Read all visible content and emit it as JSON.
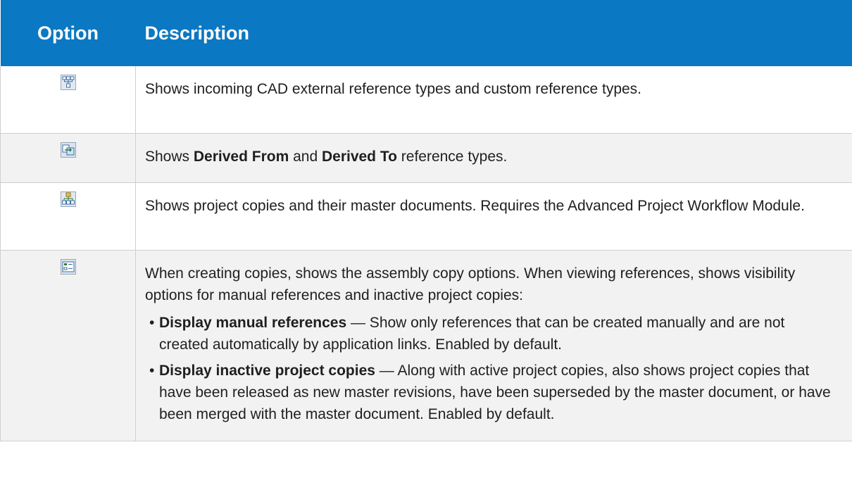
{
  "headers": {
    "option": "Option",
    "description": "Description"
  },
  "rows": [
    {
      "icon": "incoming-references-icon",
      "text": "Shows incoming CAD external reference types and custom reference types."
    },
    {
      "icon": "derived-references-icon",
      "text_a": "Shows ",
      "bold_a": "Derived From",
      "text_b": " and ",
      "bold_b": "Derived To",
      "text_c": " reference types."
    },
    {
      "icon": "project-copies-icon",
      "text": "Shows project copies and their master documents. Requires the Advanced Project Workflow Module."
    },
    {
      "icon": "options-list-icon",
      "text": "When creating copies, shows the assembly copy options. When viewing references, shows visibility options for manual references and inactive project copies:",
      "bullets": [
        {
          "bold": "Display manual references",
          "text": " — Show only references that can be created manually and are not created automatically by application links. Enabled by default."
        },
        {
          "bold": "Display inactive project copies",
          "text": " — Along with active project copies, also shows project copies that have been released as new master revisions, have been superseded by the master document, or have been merged with the master document. Enabled by default."
        }
      ]
    }
  ],
  "colors": {
    "header_bg": "#0a78c2",
    "alt_row_bg": "#f2f2f2"
  }
}
